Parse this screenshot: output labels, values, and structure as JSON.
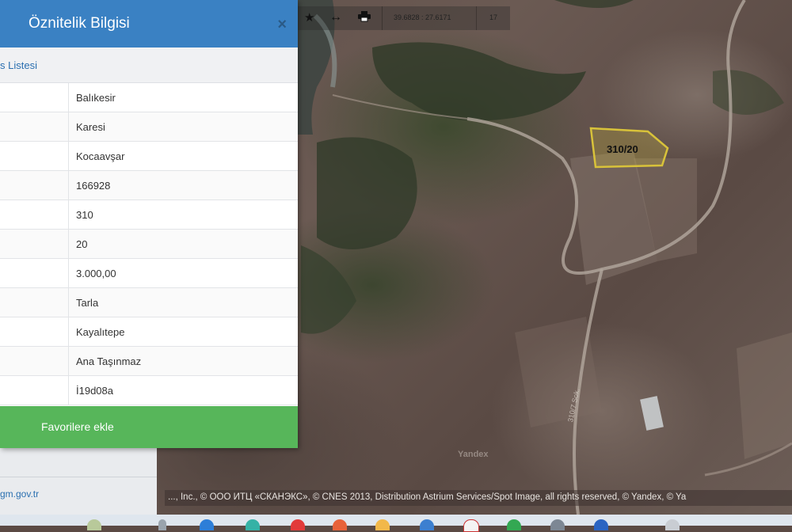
{
  "panel": {
    "title": "Öznitelik Bilgisi",
    "close_icon": "×",
    "subheader": "s Listesi",
    "rows": [
      {
        "value": "Balıkesir"
      },
      {
        "value": "Karesi"
      },
      {
        "value": "Kocaavşar"
      },
      {
        "value": "166928"
      },
      {
        "value": "310"
      },
      {
        "value": "20"
      },
      {
        "value": "3.000,00"
      },
      {
        "value": "Tarla"
      },
      {
        "value": "Kayalıtepe"
      },
      {
        "value": "Ana Taşınmaz"
      },
      {
        "value": "İ19d08a"
      }
    ],
    "favorite_label": "Favorilere ekle"
  },
  "sidebar": {
    "site_link": "gm.gov.tr"
  },
  "toolbar": {
    "star_icon": "★",
    "measure_icon": "↔",
    "print_icon": "🖶",
    "coordinates": "39.6828 : 27.6171",
    "zoom_level": "17"
  },
  "map": {
    "parcel_label": "310/20",
    "road_label": "310/7  Sok.",
    "watermark": "Yandex",
    "attribution": "..., Inc., © ООО ИТЦ «СКАНЭКС», © CNES 2013, Distribution Astrium Services/Spot Image, all rights reserved, © Yandex, © Ya",
    "parcel_outline_color": "#d8c23a"
  },
  "taskbar": {
    "icons": [
      "weather-icon",
      "search-icon",
      "edge-icon",
      "chrome-icon",
      "opera-icon",
      "explorer-icon",
      "store-icon",
      "photos-icon",
      "whatsapp-icon",
      "settings-icon",
      "word-icon",
      "app-icon"
    ]
  }
}
